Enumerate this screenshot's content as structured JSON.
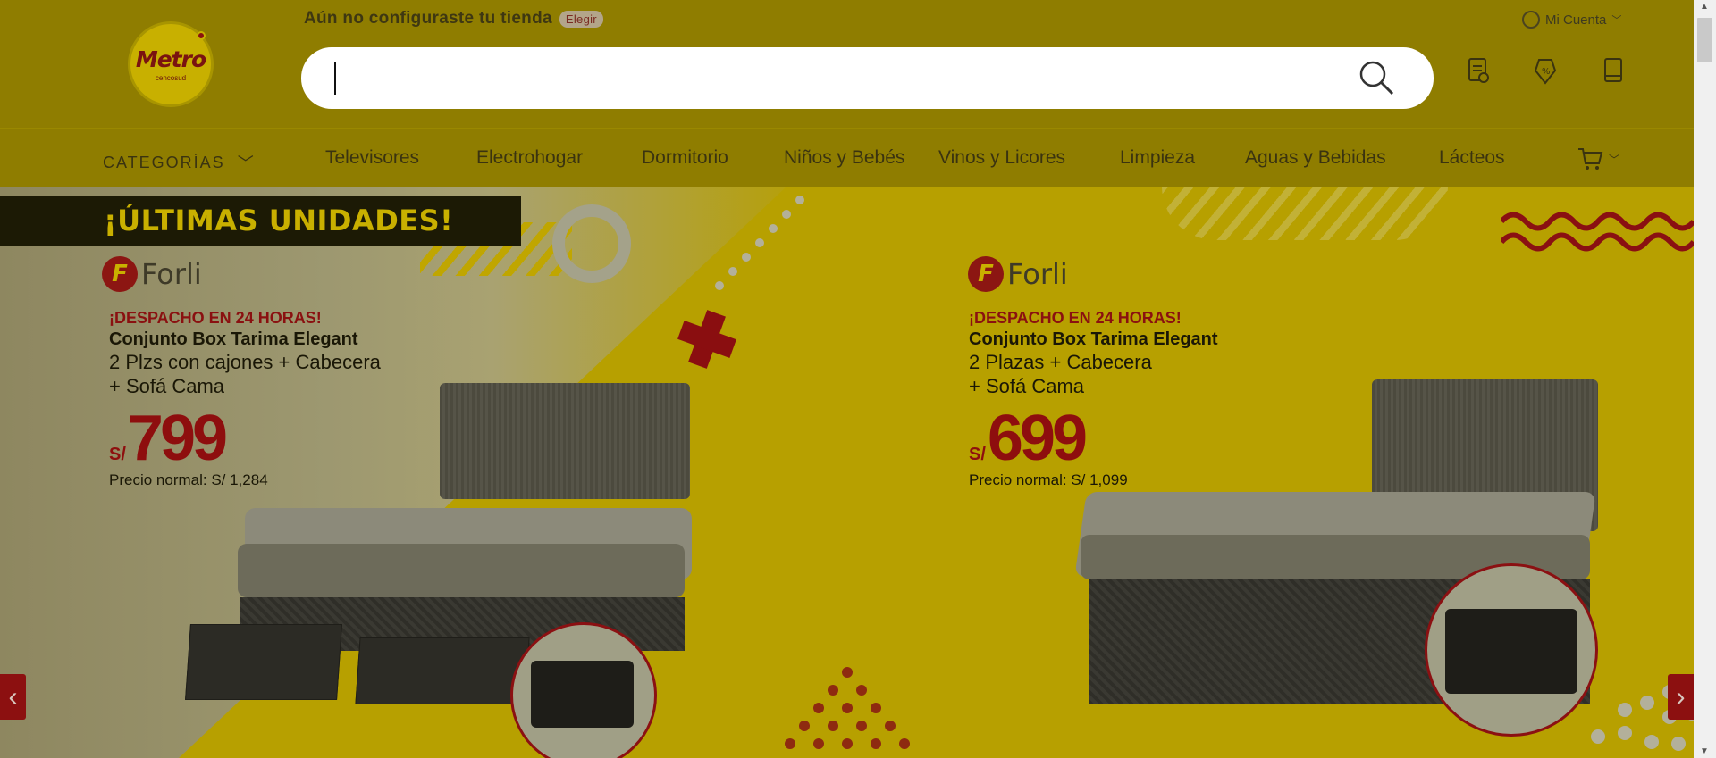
{
  "header": {
    "logo_text": "Metro",
    "logo_sub": "cencosud",
    "store_message": "Aún no configuraste tu tienda",
    "store_action": "Elegir",
    "account_label": "Mi Cuenta",
    "search": {
      "value": "",
      "placeholder": ""
    },
    "icons": [
      "orders-icon",
      "coupons-icon",
      "list-icon"
    ]
  },
  "nav": {
    "categories_label": "CATEGORÍAS",
    "items": [
      "Televisores",
      "Electrohogar",
      "Dormitorio",
      "Niños y Bebés",
      "Vinos y Licores",
      "Limpieza",
      "Aguas y Bebidas",
      "Lácteos"
    ]
  },
  "banner": {
    "headline": "¡ÚLTIMAS UNIDADES!",
    "brand": "Forli",
    "offers": [
      {
        "ship": "¡DESPACHO EN 24 HORAS!",
        "name": "Conjunto Box Tarima Elegant",
        "line1": "2 Plzs con cajones + Cabecera",
        "line2": "+ Sofá Cama",
        "currency": "S/",
        "price": "799",
        "normal_price": "Precio normal: S/ 1,284"
      },
      {
        "ship": "¡DESPACHO EN 24 HORAS!",
        "name": "Conjunto Box Tarima Elegant",
        "line1": "2 Plazas + Cabecera",
        "line2": "+ Sofá Cama",
        "currency": "S/",
        "price": "699",
        "normal_price": "Precio normal: S/ 1,099"
      }
    ],
    "prev_arrow": "‹",
    "next_arrow": "›"
  },
  "colors": {
    "header_bg": "#8f7d00",
    "banner_bg": "#b7a000",
    "accent_red": "#8c1010"
  }
}
